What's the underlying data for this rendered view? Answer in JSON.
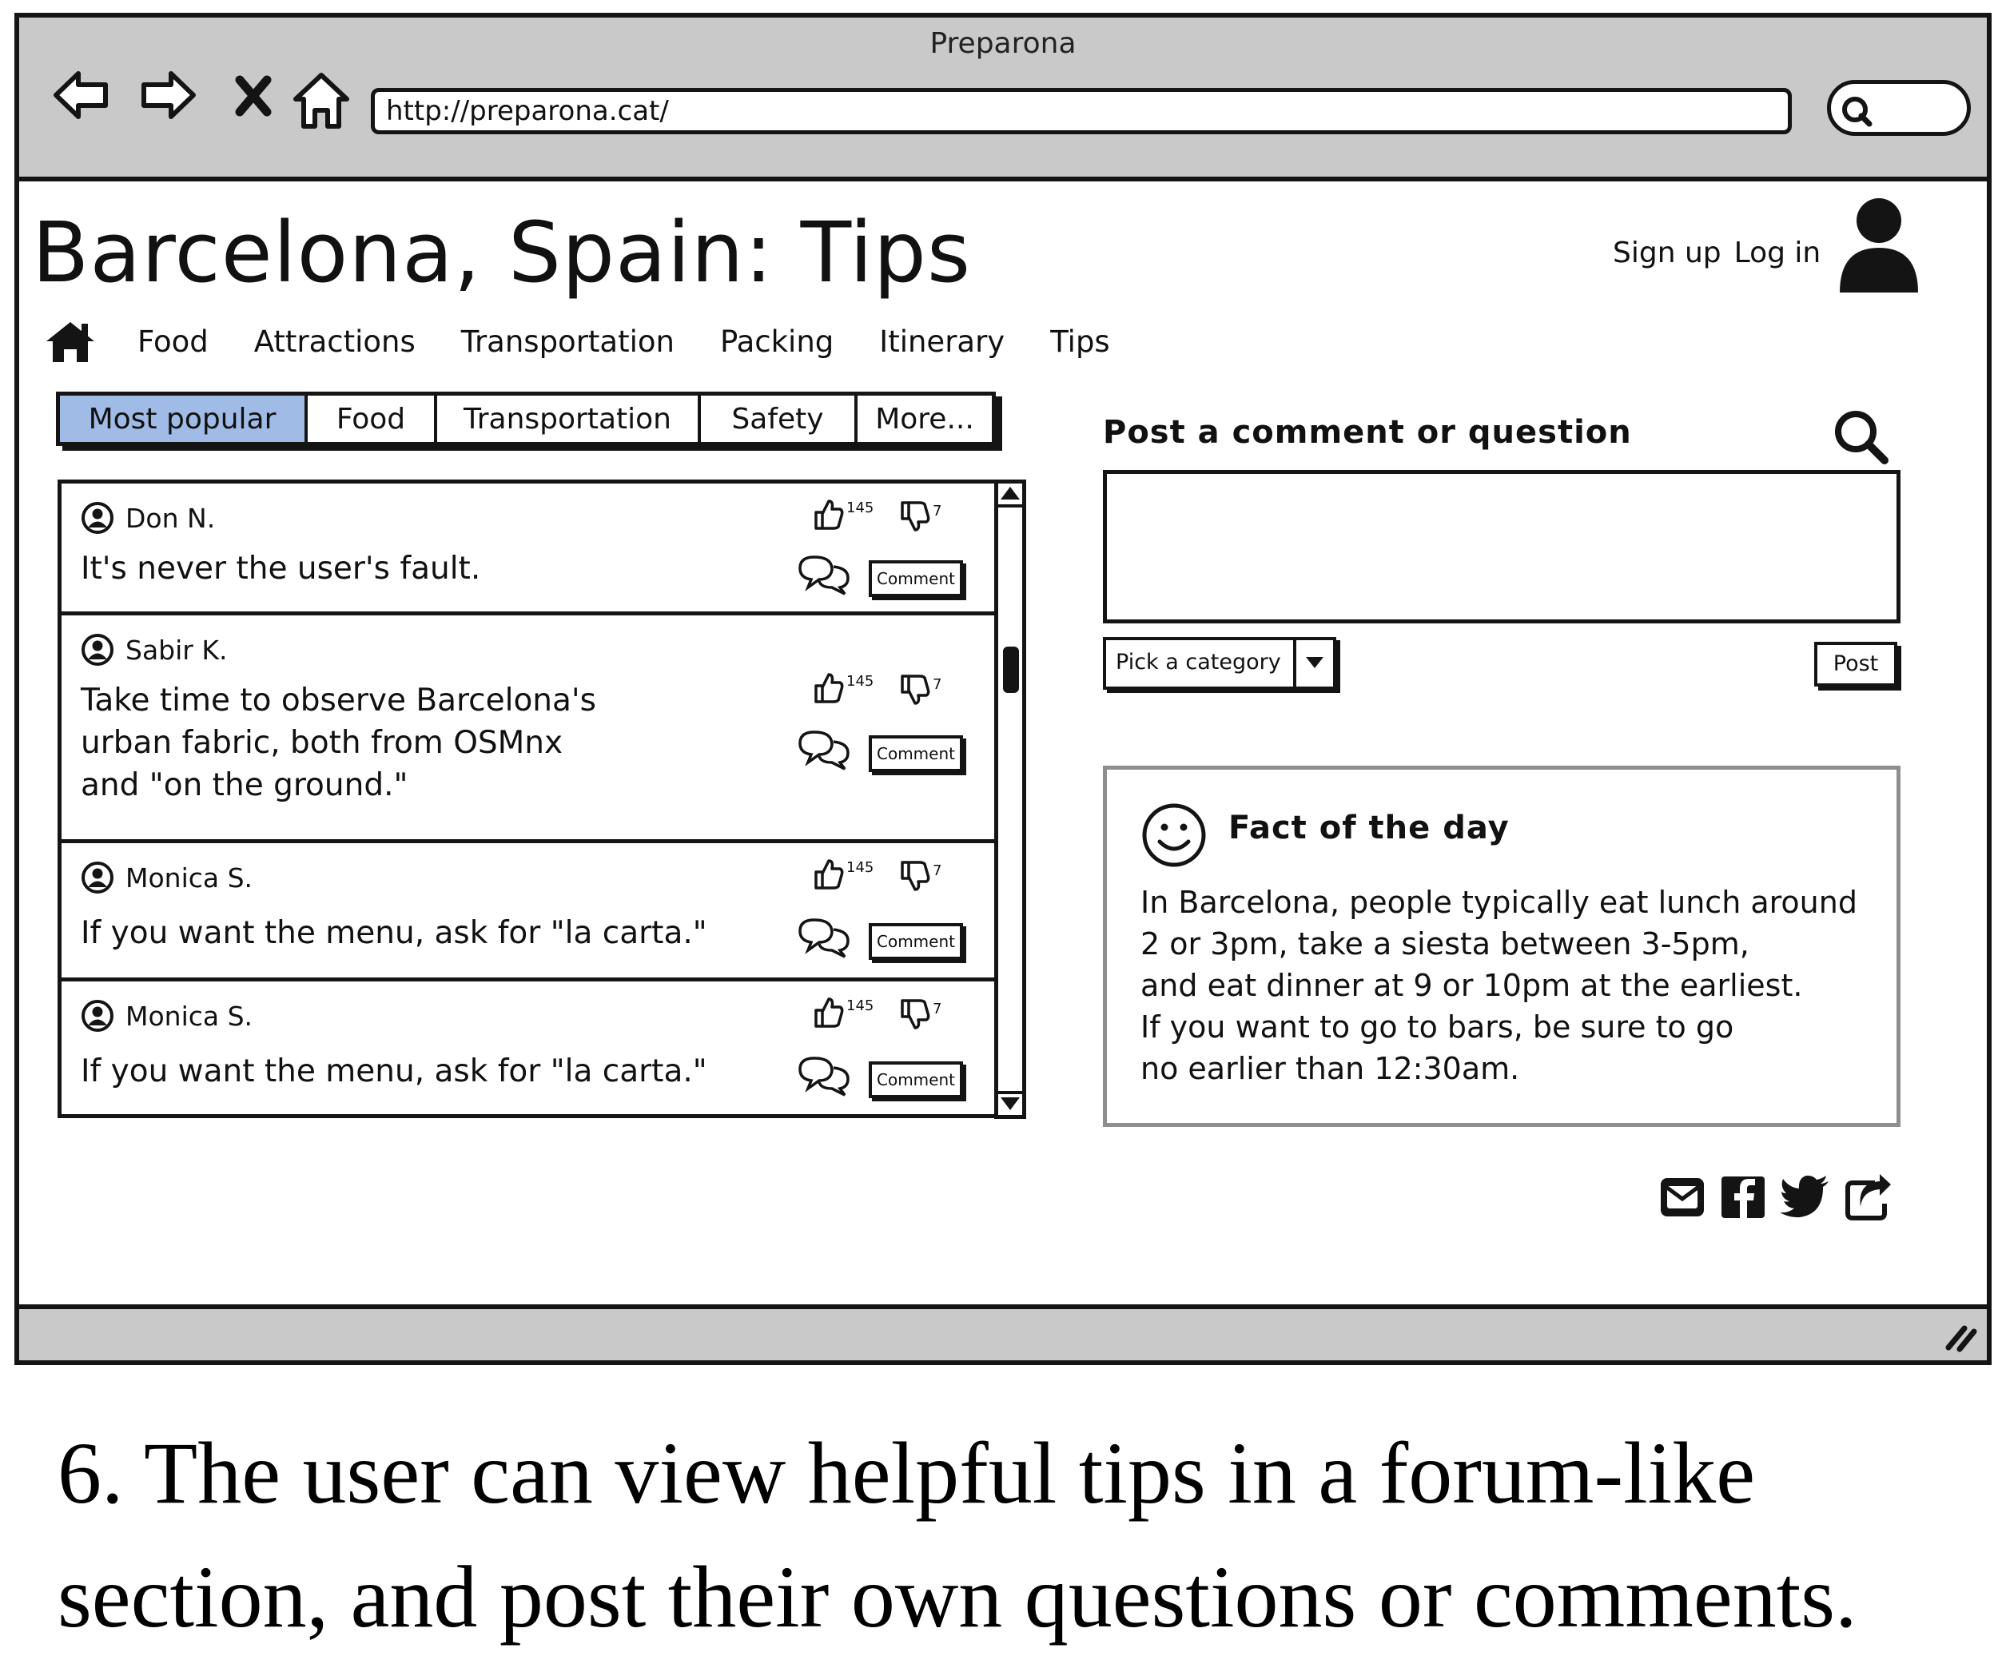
{
  "window": {
    "title": "Preparona",
    "url": "http://preparona.cat/"
  },
  "header": {
    "title": "Barcelona, Spain: Tips",
    "sign_up": "Sign up",
    "log_in": "Log in"
  },
  "nav": {
    "items": [
      "Food",
      "Attractions",
      "Transportation",
      "Packing",
      "Itinerary",
      "Tips"
    ]
  },
  "filter_tabs": {
    "items": [
      "Most popular",
      "Food",
      "Transportation",
      "Safety",
      "More..."
    ],
    "active": "Most popular"
  },
  "tips": [
    {
      "author": "Don N.",
      "lines": [
        "It's never the user's fault."
      ],
      "likes": "145",
      "dislikes": "7",
      "comment_label": "Comment"
    },
    {
      "author": "Sabir K.",
      "lines": [
        "Take time to observe Barcelona's",
        "urban fabric, both from OSMnx",
        "and \"on the ground.\""
      ],
      "likes": "145",
      "dislikes": "7",
      "comment_label": "Comment"
    },
    {
      "author": "Monica S.",
      "lines": [
        "If you want the menu, ask for \"la carta.\""
      ],
      "likes": "145",
      "dislikes": "7",
      "comment_label": "Comment"
    },
    {
      "author": "Monica S.",
      "lines": [
        "If you want the menu, ask for \"la carta.\""
      ],
      "likes": "145",
      "dislikes": "7",
      "comment_label": "Comment"
    }
  ],
  "post": {
    "heading": "Post a comment or question",
    "category_placeholder": "Pick a category",
    "post_label": "Post",
    "textarea_value": ""
  },
  "fact": {
    "title": "Fact of the day",
    "lines": [
      "In Barcelona, people typically eat lunch around",
      "2 or 3pm, take a siesta between 3-5pm,",
      "and eat dinner at 9 or 10pm at the earliest.",
      "If you want to go to bars, be sure to go",
      "no earlier than 12:30am."
    ]
  },
  "share": {
    "icons": [
      "email-icon",
      "facebook-icon",
      "twitter-icon",
      "share-icon"
    ]
  },
  "caption": {
    "lines": [
      "6. The user can view helpful tips in a forum-like",
      "section, and post their own questions or comments."
    ]
  },
  "colors": {
    "active_tab": "#9fbbe6",
    "chrome": "#c9c9c9",
    "ink": "#141414"
  }
}
